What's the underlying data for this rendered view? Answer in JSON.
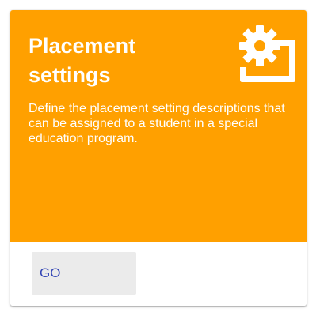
{
  "card": {
    "title": "Placement settings",
    "description": "Define the placement setting descriptions that can be assigned to a student in a special education program.",
    "icon": "settings-applications-icon",
    "action_label": "GO",
    "colors": {
      "header_background": "#ffa000",
      "header_text": "#ffffff",
      "button_background": "#ebebeb",
      "button_text": "#3346b5"
    }
  }
}
